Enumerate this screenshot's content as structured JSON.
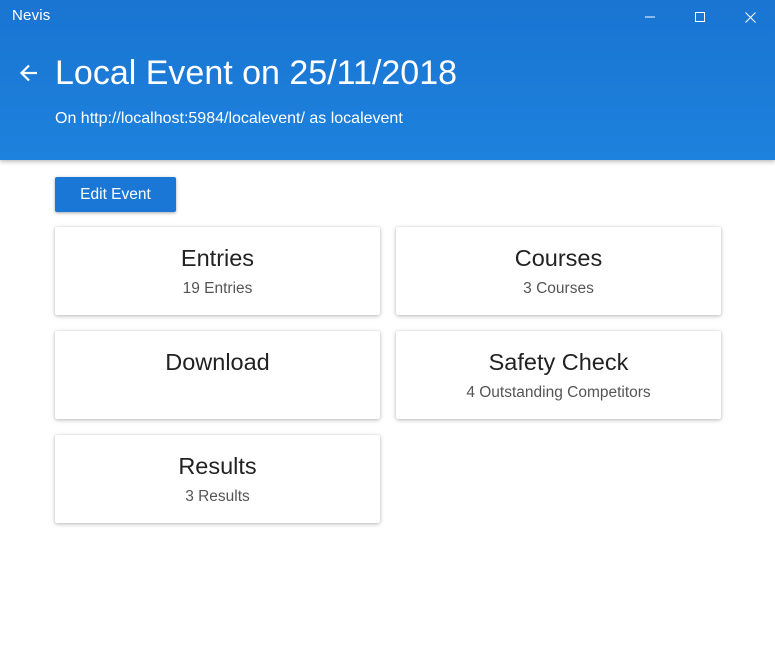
{
  "app": {
    "name": "Nevis"
  },
  "window_controls": {
    "minimize_icon": "minimize-icon",
    "maximize_icon": "maximize-icon",
    "close_icon": "close-icon"
  },
  "header": {
    "back_icon": "arrow-left-icon",
    "title": "Local Event on 25/11/2018",
    "subtitle": "On http://localhost:5984/localevent/ as localevent",
    "color": "#1a77d6"
  },
  "toolbar": {
    "edit_label": "Edit Event"
  },
  "cards": {
    "entries": {
      "title": "Entries",
      "subtitle": "19 Entries"
    },
    "courses": {
      "title": "Courses",
      "subtitle": "3 Courses"
    },
    "download": {
      "title": "Download",
      "subtitle": ""
    },
    "safety": {
      "title": "Safety Check",
      "subtitle": "4 Outstanding Competitors"
    },
    "results": {
      "title": "Results",
      "subtitle": "3 Results"
    }
  }
}
